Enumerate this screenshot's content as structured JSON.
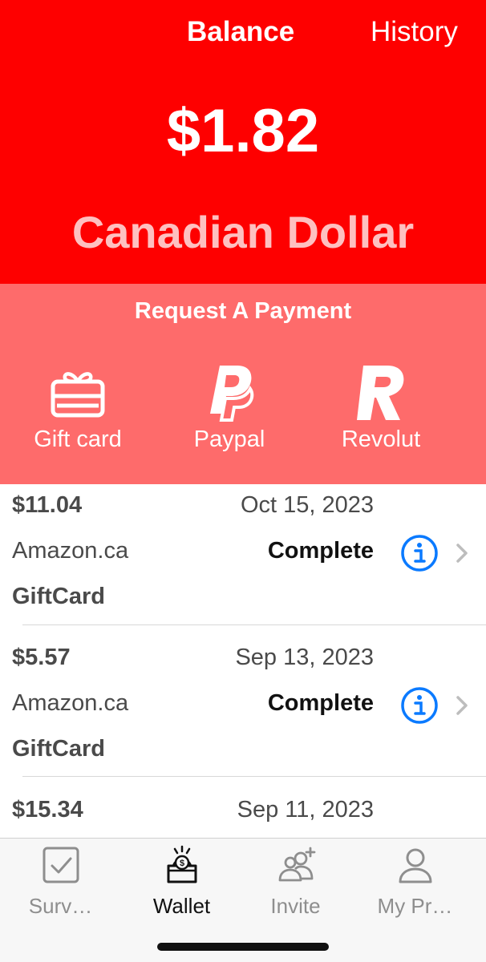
{
  "header": {
    "tabs": [
      {
        "label": "Balance",
        "active": true
      },
      {
        "label": "History",
        "active": false
      }
    ],
    "balance_amount": "$1.82",
    "currency": "Canadian Dollar",
    "background_color": "#fe0000"
  },
  "request": {
    "title": "Request A Payment",
    "background_color": "#fe6b6b",
    "options": [
      {
        "label": "Gift card",
        "icon": "gift-card-icon"
      },
      {
        "label": "Paypal",
        "icon": "paypal-icon"
      },
      {
        "label": "Revolut",
        "icon": "revolut-icon"
      }
    ]
  },
  "transactions": [
    {
      "amount": "$11.04",
      "date": "Oct 15, 2023",
      "merchant": "Amazon.ca",
      "status": "Complete",
      "type": "GiftCard"
    },
    {
      "amount": "$5.57",
      "date": "Sep 13, 2023",
      "merchant": "Amazon.ca",
      "status": "Complete",
      "type": "GiftCard"
    },
    {
      "amount": "$15.34",
      "date": "Sep 11, 2023",
      "merchant": "",
      "status": "",
      "type": ""
    }
  ],
  "tabbar": {
    "items": [
      {
        "label": "Surv…",
        "icon": "checkbox-icon",
        "active": false
      },
      {
        "label": "Wallet",
        "icon": "wallet-icon",
        "active": true
      },
      {
        "label": "Invite",
        "icon": "invite-people-icon",
        "active": false
      },
      {
        "label": "My Pr…",
        "icon": "person-icon",
        "active": false
      }
    ]
  },
  "colors": {
    "accent_blue": "#0a7aff",
    "inactive_tab": "#8e8e8e"
  }
}
